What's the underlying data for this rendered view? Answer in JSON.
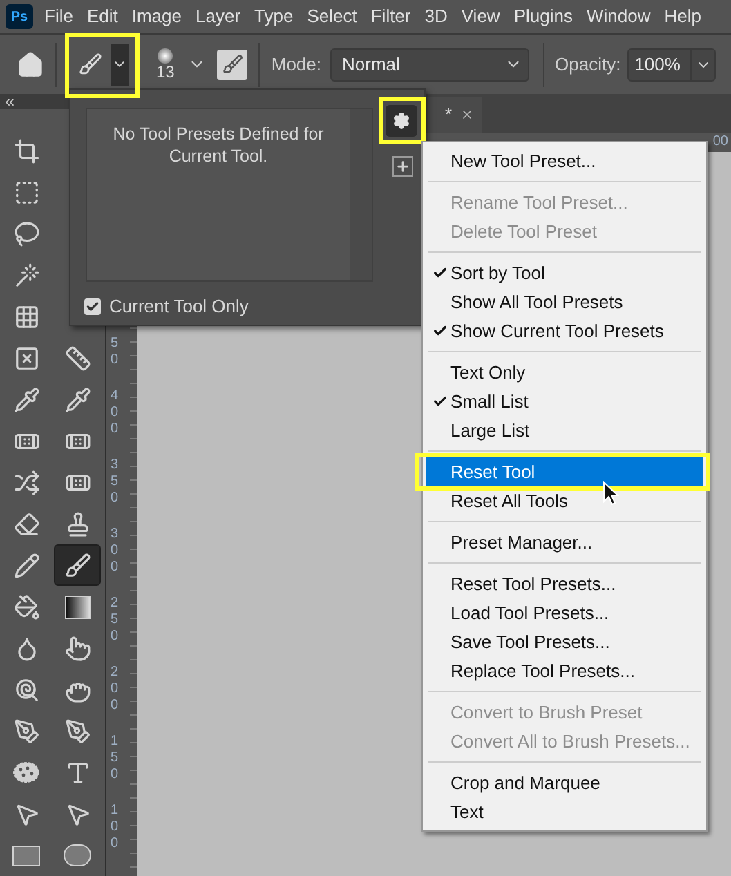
{
  "app_logo": "Ps",
  "menu_bar": [
    "File",
    "Edit",
    "Image",
    "Layer",
    "Type",
    "Select",
    "Filter",
    "3D",
    "View",
    "Plugins",
    "Window",
    "Help"
  ],
  "options_bar": {
    "preset_picker": {
      "outlined": true
    },
    "brush_size": "13",
    "mode_label": "Mode:",
    "mode_value": "Normal",
    "opacity_label": "Opacity:",
    "opacity_value": "100%"
  },
  "tools": {
    "left": [
      {
        "selected": false
      },
      {
        "selected": false
      },
      {
        "selected": false
      },
      {
        "selected": false
      },
      {
        "selected": false
      },
      {
        "selected": false
      },
      {
        "selected": false
      },
      {
        "selected": false
      },
      {
        "selected": false
      },
      {
        "selected": false
      },
      {
        "selected": false
      },
      {
        "selected": false
      },
      {
        "selected": false
      },
      {
        "selected": false
      },
      {
        "selected": false
      },
      {
        "selected": false
      },
      {
        "selected": false
      },
      {
        "selected": false
      }
    ],
    "right": [
      {
        "selected": false
      },
      {
        "selected": false
      },
      {
        "selected": false
      },
      {
        "selected": false
      },
      {
        "selected": false
      },
      {
        "selected": true
      },
      {
        "selected": false
      },
      {
        "selected": false
      },
      {
        "selected": false
      },
      {
        "selected": false
      },
      {
        "selected": false
      },
      {
        "selected": false
      },
      {
        "selected": false
      }
    ]
  },
  "ruler": {
    "vertical_labels": [
      "50",
      "400",
      "350",
      "300",
      "250",
      "200",
      "150",
      "100"
    ],
    "horizontal_labels": [
      "00"
    ]
  },
  "document_tab": {
    "title": "*"
  },
  "presets_panel": {
    "empty_message": "No Tool Presets Defined for Current Tool.",
    "current_tool_only": {
      "label": "Current Tool Only",
      "checked": true
    },
    "settings_button": {
      "outlined": true
    }
  },
  "panel_menu": {
    "groups": [
      [
        {
          "label": "New Tool Preset...",
          "checked": false,
          "disabled": false,
          "selected": false,
          "outlined": false
        }
      ],
      [
        {
          "label": "Rename Tool Preset...",
          "checked": false,
          "disabled": true,
          "selected": false,
          "outlined": false
        },
        {
          "label": "Delete Tool Preset",
          "checked": false,
          "disabled": true,
          "selected": false,
          "outlined": false
        }
      ],
      [
        {
          "label": "Sort by Tool",
          "checked": true,
          "disabled": false,
          "selected": false,
          "outlined": false
        },
        {
          "label": "Show All Tool Presets",
          "checked": false,
          "disabled": false,
          "selected": false,
          "outlined": false
        },
        {
          "label": "Show Current Tool Presets",
          "checked": true,
          "disabled": false,
          "selected": false,
          "outlined": false
        }
      ],
      [
        {
          "label": "Text Only",
          "checked": false,
          "disabled": false,
          "selected": false,
          "outlined": false
        },
        {
          "label": "Small List",
          "checked": true,
          "disabled": false,
          "selected": false,
          "outlined": false
        },
        {
          "label": "Large List",
          "checked": false,
          "disabled": false,
          "selected": false,
          "outlined": false
        }
      ],
      [
        {
          "label": "Reset Tool",
          "checked": false,
          "disabled": false,
          "selected": true,
          "outlined": true
        },
        {
          "label": "Reset All Tools",
          "checked": false,
          "disabled": false,
          "selected": false,
          "outlined": false
        }
      ],
      [
        {
          "label": "Preset Manager...",
          "checked": false,
          "disabled": false,
          "selected": false,
          "outlined": false
        }
      ],
      [
        {
          "label": "Reset Tool Presets...",
          "checked": false,
          "disabled": false,
          "selected": false,
          "outlined": false
        },
        {
          "label": "Load Tool Presets...",
          "checked": false,
          "disabled": false,
          "selected": false,
          "outlined": false
        },
        {
          "label": "Save Tool Presets...",
          "checked": false,
          "disabled": false,
          "selected": false,
          "outlined": false
        },
        {
          "label": "Replace Tool Presets...",
          "checked": false,
          "disabled": false,
          "selected": false,
          "outlined": false
        }
      ],
      [
        {
          "label": "Convert to Brush Preset",
          "checked": false,
          "disabled": true,
          "selected": false,
          "outlined": false
        },
        {
          "label": "Convert All to Brush Presets...",
          "checked": false,
          "disabled": true,
          "selected": false,
          "outlined": false
        }
      ],
      [
        {
          "label": "Crop and Marquee",
          "checked": false,
          "disabled": false,
          "selected": false,
          "outlined": false
        },
        {
          "label": "Text",
          "checked": false,
          "disabled": false,
          "selected": false,
          "outlined": false
        }
      ]
    ]
  }
}
